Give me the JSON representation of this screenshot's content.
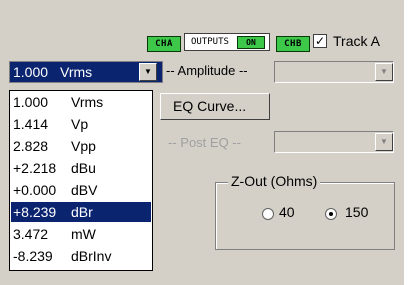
{
  "header": {
    "ch_a_led": "CHA",
    "outputs_label": "OUTPUTS",
    "outputs_on": "ON",
    "ch_b_led": "CHB",
    "track_checkbox_mark": "✓",
    "track_label": "Track A"
  },
  "amplitude": {
    "selected_value": "1.000",
    "selected_unit": "Vrms",
    "label": "-- Amplitude --"
  },
  "eq_curve_button": "EQ Curve...",
  "post_eq_label": "-- Post EQ --",
  "zout": {
    "title": "Z-Out (Ohms)",
    "option_40": "40",
    "option_150": "150",
    "selected": "150"
  },
  "unit_options": [
    {
      "num": "1.000",
      "unit": "Vrms"
    },
    {
      "num": "1.414",
      "unit": "Vp"
    },
    {
      "num": "2.828",
      "unit": "Vpp"
    },
    {
      "num": "+2.218",
      "unit": "dBu"
    },
    {
      "num": "+0.000",
      "unit": "dBV"
    },
    {
      "num": "+8.239",
      "unit": "dBr"
    },
    {
      "num": "3.472",
      "unit": "mW"
    },
    {
      "num": "-8.239",
      "unit": "dBrInv"
    }
  ],
  "selected_option_index": 5,
  "icons": {
    "dropdown_arrow": "▼"
  }
}
